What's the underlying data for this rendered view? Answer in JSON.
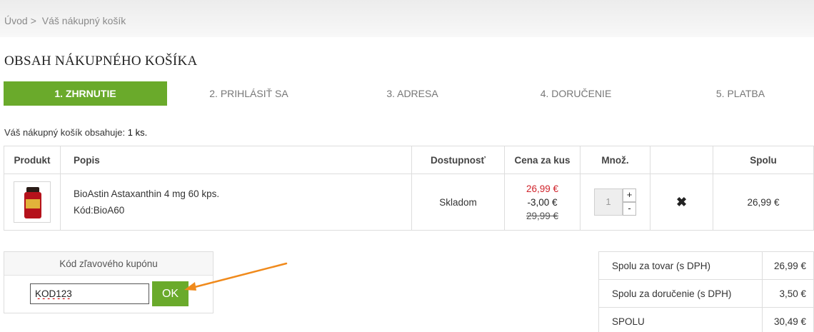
{
  "breadcrumb": {
    "home": "Úvod",
    "separator": ">",
    "current": "Váš nákupný košík"
  },
  "page_title": "OBSAH NÁKUPNÉHO KOŠÍKA",
  "steps": [
    {
      "label": "1. ZHRNUTIE",
      "active": true
    },
    {
      "label": "2. PRIHLÁSIŤ SA",
      "active": false
    },
    {
      "label": "3. ADRESA",
      "active": false
    },
    {
      "label": "4. DORUČENIE",
      "active": false
    },
    {
      "label": "5. PLATBA",
      "active": false
    }
  ],
  "summary": {
    "prefix": "Váš nákupný košík obsahuje:",
    "count": "1 ks."
  },
  "cart_table": {
    "headers": {
      "product": "Produkt",
      "description": "Popis",
      "availability": "Dostupnosť",
      "unit_price": "Cena za kus",
      "quantity": "Množ.",
      "total": "Spolu"
    },
    "rows": [
      {
        "image_icon": "supplement-bottle-icon",
        "name": "BioAstin Astaxanthin 4 mg 60 kps.",
        "code": "Kód:BioA60",
        "availability": "Skladom",
        "price_new": "26,99 €",
        "price_discount": "-3,00 €",
        "price_old": "29,99 €",
        "quantity": "1",
        "plus": "+",
        "minus": "-",
        "remove_icon": "✖",
        "total": "26,99 €"
      }
    ]
  },
  "coupon": {
    "title": "Kód zľavového kupónu",
    "value": "KOD123",
    "button": "OK"
  },
  "totals": [
    {
      "label": "Spolu za tovar (s DPH)",
      "value": "26,99 €"
    },
    {
      "label": "Spolu za doručenie (s DPH)",
      "value": "3,50 €"
    },
    {
      "label": "SPOLU",
      "value": "30,49 €"
    }
  ],
  "colors": {
    "accent": "#6aaa2b",
    "price_red": "#d0232b",
    "annotation_arrow": "#f08a1c"
  }
}
